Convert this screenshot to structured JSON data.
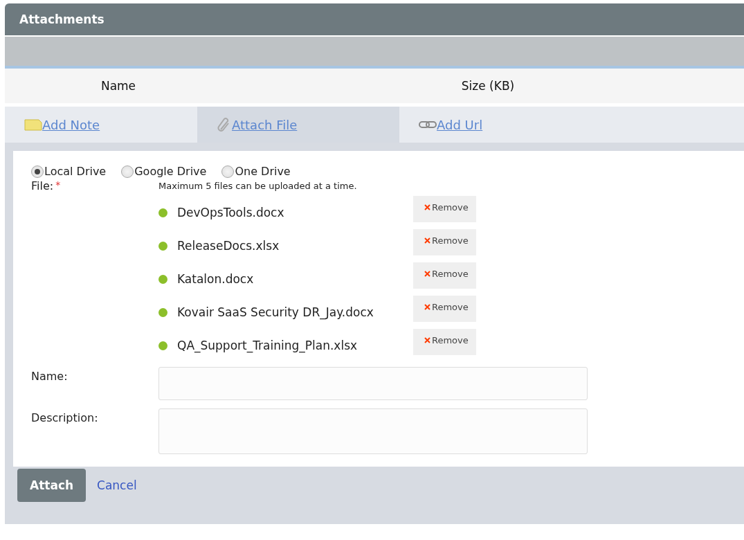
{
  "panel": {
    "title": "Attachments"
  },
  "columns": [
    "Name",
    "Size (KB)"
  ],
  "tabs": [
    {
      "label": "Add Note",
      "kind": "note",
      "selected": false
    },
    {
      "label": "Attach File",
      "kind": "clip",
      "selected": true
    },
    {
      "label": "Add Url",
      "kind": "link",
      "selected": false
    }
  ],
  "sources": [
    {
      "label": "Local Drive",
      "selected": true
    },
    {
      "label": "Google Drive",
      "selected": false
    },
    {
      "label": "One Drive",
      "selected": false
    }
  ],
  "file_label": "File:",
  "required_mark": "*",
  "hint": "Maximum 5 files can be uploaded at a time.",
  "files": [
    {
      "name": "DevOpsTools.docx",
      "remove": "Remove",
      "color": "#8cbf2a"
    },
    {
      "name": "ReleaseDocs.xlsx",
      "remove": "Remove",
      "color": "#8cbf2a"
    },
    {
      "name": "Katalon.docx",
      "remove": "Remove",
      "color": "#8cbf2a"
    },
    {
      "name": "Kovair SaaS Security DR_Jay.docx",
      "remove": "Remove",
      "color": "#8cbf2a"
    },
    {
      "name": "QA_Support_Training_Plan.xlsx",
      "remove": "Remove",
      "color": "#8cbf2a"
    }
  ],
  "fields": [
    {
      "label": "Name:",
      "kind": "line"
    },
    {
      "label": "Description:",
      "kind": "area"
    }
  ],
  "buttons": {
    "primary": "Attach",
    "secondary": "Cancel"
  }
}
